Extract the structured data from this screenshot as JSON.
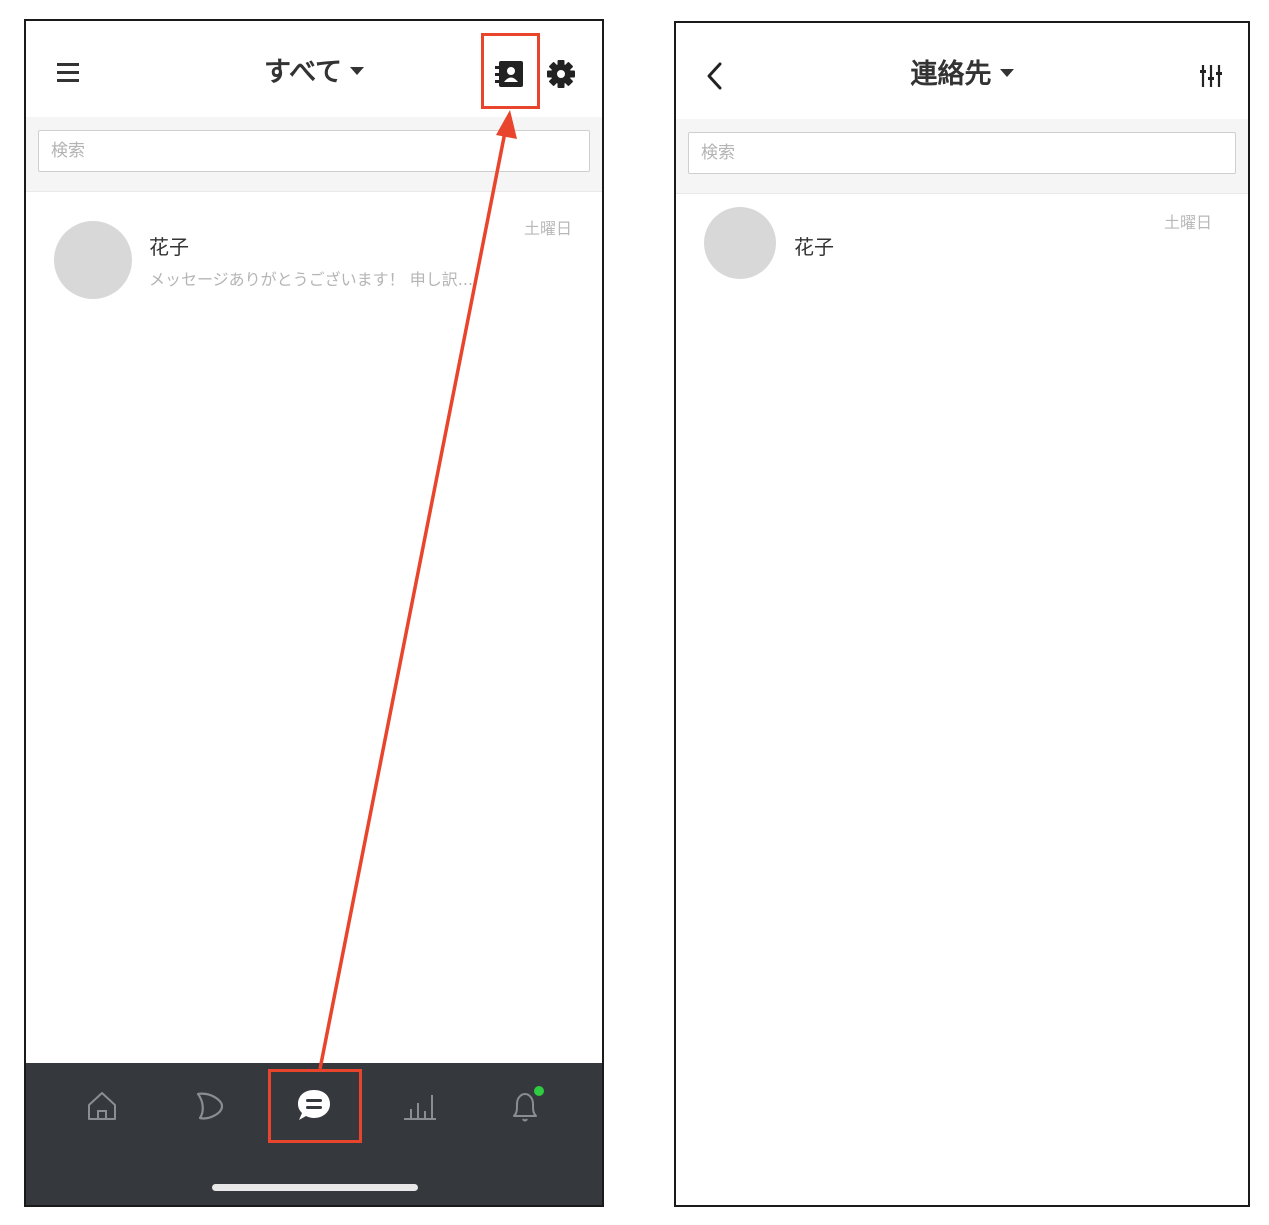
{
  "left": {
    "header": {
      "title": "すべて"
    },
    "search": {
      "placeholder": "検索"
    },
    "conversations": [
      {
        "name": "花子",
        "preview": "メッセージありがとうございます！ 申し訳...",
        "date": "土曜日"
      }
    ],
    "bottom_nav": {
      "items": [
        "home-icon",
        "play-icon",
        "chat-icon",
        "stats-icon",
        "bell-icon"
      ],
      "active": "chat-icon",
      "notification_dot_color": "#2ecc40"
    }
  },
  "right": {
    "header": {
      "title": "連絡先"
    },
    "search": {
      "placeholder": "検索"
    },
    "contacts": [
      {
        "name": "花子",
        "date": "土曜日"
      }
    ]
  },
  "annotation": {
    "color": "#e8452c"
  }
}
